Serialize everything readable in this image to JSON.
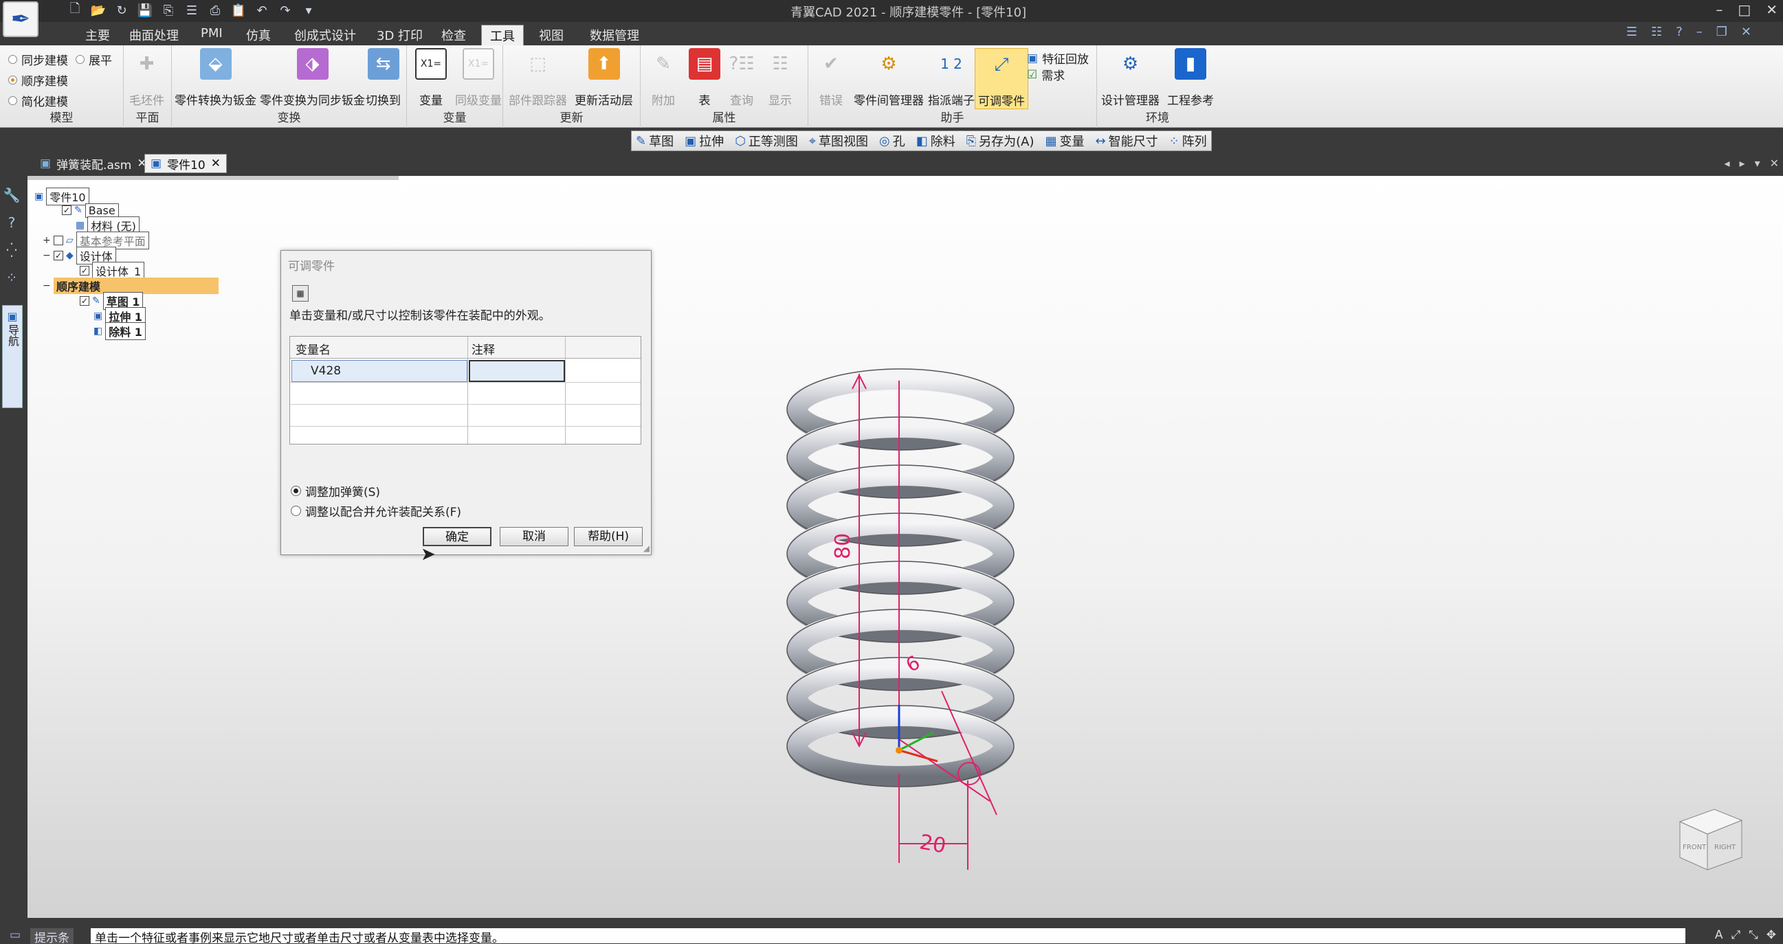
{
  "app": {
    "window_title": "青翼CAD 2021 - 顺序建模零件 - [零件10]",
    "logo_glyph": "✒"
  },
  "qat": {
    "icons": [
      "new-file-icon",
      "open-icon",
      "recent-icon",
      "save-icon",
      "save-all-icon",
      "list-icon",
      "print-icon",
      "clipboard-icon",
      "undo-icon",
      "redo-icon",
      "customize-icon"
    ]
  },
  "window_controls": [
    "–",
    "□",
    "✕"
  ],
  "ribbon_tabs": [
    "主要",
    "曲面处理",
    "PMI",
    "仿真",
    "创成式设计",
    "3D 打印",
    "检查",
    "工具",
    "视图",
    "数据管理"
  ],
  "active_tab": "工具",
  "ribbon": {
    "model_group": {
      "label": "模型",
      "opt_sync": "同步建模",
      "opt_flat": "展平",
      "opt_sequential": "顺序建模",
      "opt_simplified": "简化建模"
    },
    "plane_group": {
      "label": "平面",
      "btn": "毛坯件"
    },
    "convert_group": {
      "label": "变换",
      "btn1": "零件转换为钣金",
      "btn2": "零件变换为同步钣金",
      "btn3": "切换到"
    },
    "variables_group": {
      "label": "变量",
      "btn1": "变量",
      "btn2": "同级变量"
    },
    "update_group": {
      "label": "更新",
      "btn1": "部件跟踪器",
      "btn2": "更新活动层"
    },
    "properties_group": {
      "label": "属性",
      "btn1": "附加",
      "btn2": "表",
      "btn3": "查询",
      "btn4": "显示"
    },
    "assistant_group": {
      "label": "助手",
      "btn1": "错误",
      "btn2": "零件间管理器",
      "btn3": "指派端子",
      "btn4": "可调零件",
      "side1": "特征回放",
      "side2": "需求"
    },
    "environment_group": {
      "label": "环境",
      "btn1": "设计管理器",
      "btn2": "工程参考"
    }
  },
  "command_bar": [
    "草图",
    "拉伸",
    "正等测图",
    "草图视图",
    "孔",
    "除料",
    "另存为(A)",
    "变量",
    "智能尺寸",
    "阵列"
  ],
  "doc_tabs": [
    {
      "label": "弹簧装配.asm",
      "active": false
    },
    {
      "label": "零件10",
      "active": true
    }
  ],
  "tree": {
    "root": "零件10",
    "base": "Base",
    "material": "材料 (无)",
    "ref_planes": "基本参考平面",
    "design_body": "设计体",
    "design_body_1": "设计体_1",
    "sequential": "顺序建模",
    "sketch": "草图 1",
    "extrude": "拉伸 1",
    "cut": "除料 1"
  },
  "dialog": {
    "title": "可调零件",
    "description": "单击变量和/或尺寸以控制该零件在装配中的外观。",
    "columns": [
      "变量名",
      "注释"
    ],
    "rows": [
      {
        "name": "V428",
        "comment": ""
      }
    ],
    "radio1": "调整加弹簧(S)",
    "radio2": "调整以配合并允许装配关系(F)",
    "btn_ok": "确定",
    "btn_cancel": "取消",
    "btn_help": "帮助(H)"
  },
  "model": {
    "dim_height": "80",
    "dim_pitch": "6",
    "dim_width": "20"
  },
  "navcube": {
    "front": "FRONT",
    "right": "RIGHT"
  },
  "status": {
    "label": "提示条",
    "message": "单击一个特征或者事例来显示它地尺寸或者单击尺寸或者从变量表中选择变量。"
  }
}
